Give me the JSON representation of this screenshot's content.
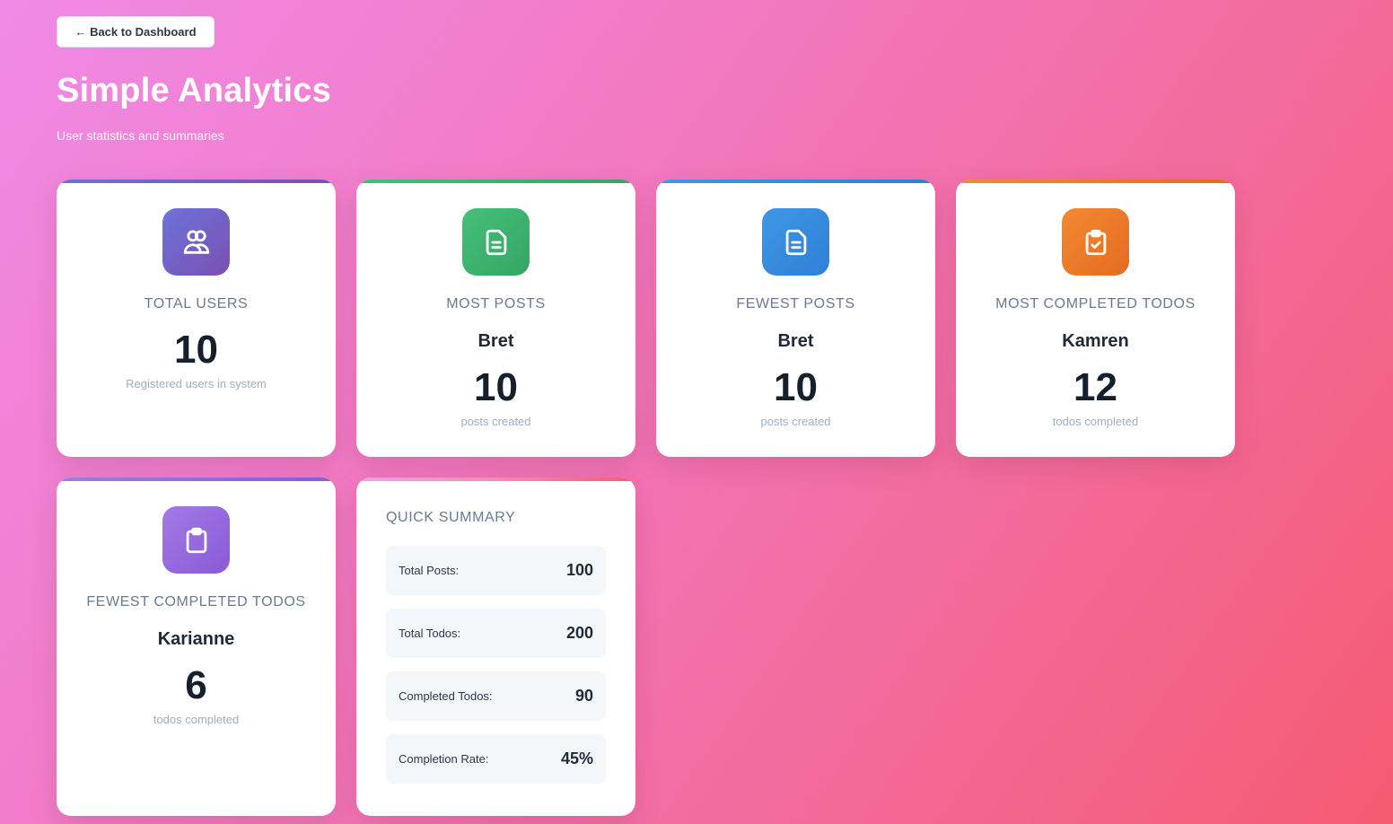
{
  "nav": {
    "back_label": "← Back to Dashboard"
  },
  "header": {
    "title": "Simple Analytics",
    "subtitle": "User statistics and summaries"
  },
  "colors": {
    "users_accent": "#7069d6",
    "most_posts_accent": "#3fb56f",
    "fewest_posts_accent": "#3b8ee0",
    "most_todos_accent": "#ee7e2d",
    "fewest_todos_accent": "#9b6ee0",
    "summary_accent": "#f07ab0"
  },
  "cards": {
    "total_users": {
      "icon": "users-icon",
      "label": "Total Users",
      "value": "10",
      "caption": "Registered users in system"
    },
    "most_posts": {
      "icon": "document-icon",
      "label": "Most Posts",
      "name": "Bret",
      "value": "10",
      "caption": "posts created"
    },
    "fewest_posts": {
      "icon": "document-icon",
      "label": "Fewest Posts",
      "name": "Bret",
      "value": "10",
      "caption": "posts created"
    },
    "most_todos": {
      "icon": "clipboard-check-icon",
      "label": "Most Completed Todos",
      "name": "Kamren",
      "value": "12",
      "caption": "todos completed"
    },
    "fewest_todos": {
      "icon": "clipboard-icon",
      "label": "Fewest Completed Todos",
      "name": "Karianne",
      "value": "6",
      "caption": "todos completed"
    }
  },
  "summary": {
    "title": "Quick Summary",
    "rows": [
      {
        "label": "Total Posts:",
        "value": "100"
      },
      {
        "label": "Total Todos:",
        "value": "200"
      },
      {
        "label": "Completed Todos:",
        "value": "90"
      },
      {
        "label": "Completion Rate:",
        "value": "45%"
      }
    ]
  }
}
